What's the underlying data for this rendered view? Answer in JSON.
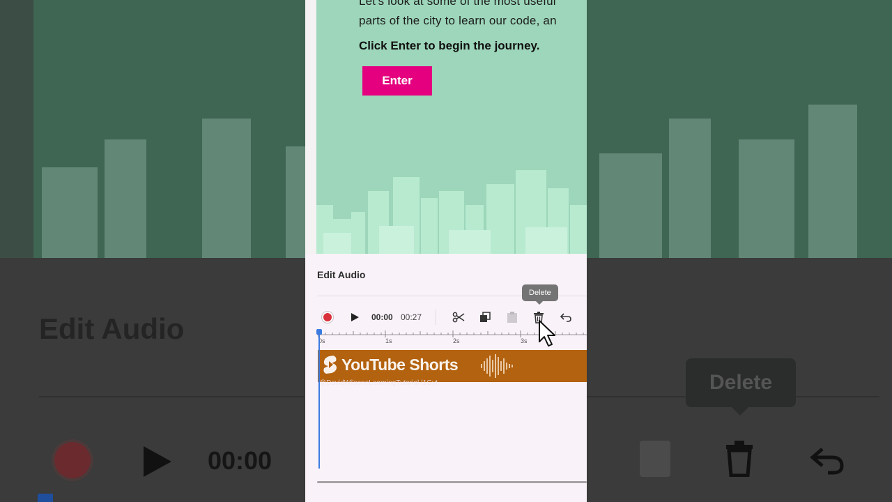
{
  "slide": {
    "line1": "Let's look at some of the most useful",
    "line2": "parts of the city to learn our code, an",
    "instruction": "Click Enter to begin the journey.",
    "enter_label": "Enter"
  },
  "edit_audio": {
    "title": "Edit Audio",
    "time_current": "00:00",
    "time_total": "00:27",
    "tooltip": "Delete"
  },
  "ruler": [
    "0s",
    "1s",
    "2s",
    "3s"
  ],
  "track": {
    "watermark": "YouTube Shorts",
    "handle": "@DavidWilsoneLearningTutorial-l1Gyt"
  },
  "background": {
    "title": "Edit Audio",
    "time": "00:00",
    "tooltip": "Delete"
  },
  "icons": [
    "record-icon",
    "play-icon",
    "scissors-icon",
    "copy-icon",
    "paste-icon",
    "trash-icon",
    "undo-icon",
    "cursor-icon"
  ],
  "colors": {
    "slide_bg": "#9dd6ba",
    "enter_button": "#e4007f",
    "audio_track": "#b3620f",
    "record": "#d9313c",
    "playhead": "#3b7be0"
  }
}
